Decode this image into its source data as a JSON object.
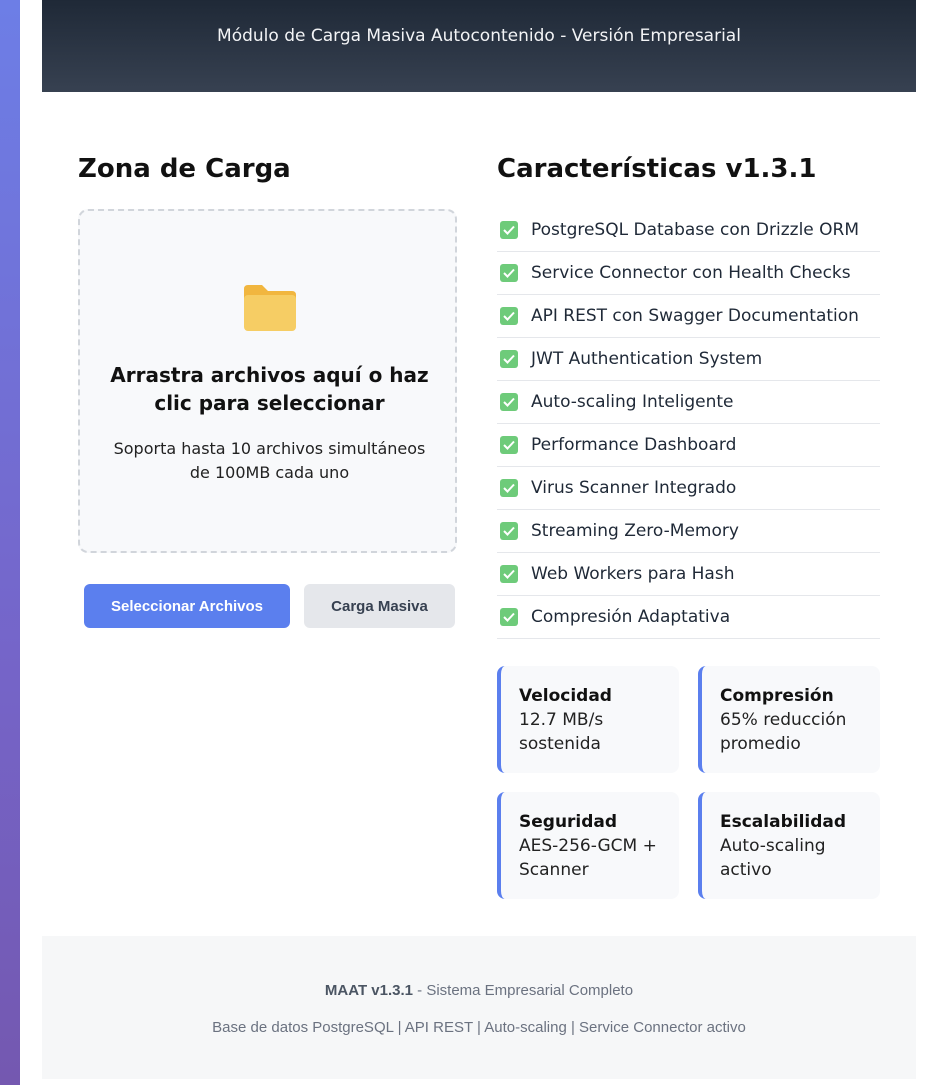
{
  "header": {
    "subtitle": "Módulo de Carga Masiva Autocontenido - Versión Empresarial"
  },
  "upload": {
    "section_title": "Zona de Carga",
    "icon": "folder-icon",
    "title": "Arrastra archivos aquí o haz clic para seleccionar",
    "hint": "Soporta hasta 10 archivos simultáneos de 100MB cada uno",
    "select_button": "Seleccionar Archivos",
    "bulk_button": "Carga Masiva"
  },
  "features": {
    "section_title": "Características v1.3.1",
    "check_icon": "check-box-icon",
    "items": [
      "PostgreSQL Database con Drizzle ORM",
      "Service Connector con Health Checks",
      "API REST con Swagger Documentation",
      "JWT Authentication System",
      "Auto-scaling Inteligente",
      "Performance Dashboard",
      "Virus Scanner Integrado",
      "Streaming Zero-Memory",
      "Web Workers para Hash",
      "Compresión Adaptativa"
    ]
  },
  "stats": [
    {
      "title": "Velocidad",
      "value": "12.7 MB/s sostenida"
    },
    {
      "title": "Compresión",
      "value": "65% reducción promedio"
    },
    {
      "title": "Seguridad",
      "value": "AES-256-GCM + Scanner"
    },
    {
      "title": "Escalabilidad",
      "value": "Auto-scaling activo"
    }
  ],
  "footer": {
    "brand": "MAAT v1.3.1",
    "tagline": " - Sistema Empresarial Completo",
    "details": "Base de datos PostgreSQL | API REST | Auto-scaling | Service Connector activo"
  },
  "colors": {
    "accent": "#5b7fee",
    "check": "#6ecb7a",
    "header_dark": "#1f2937"
  }
}
